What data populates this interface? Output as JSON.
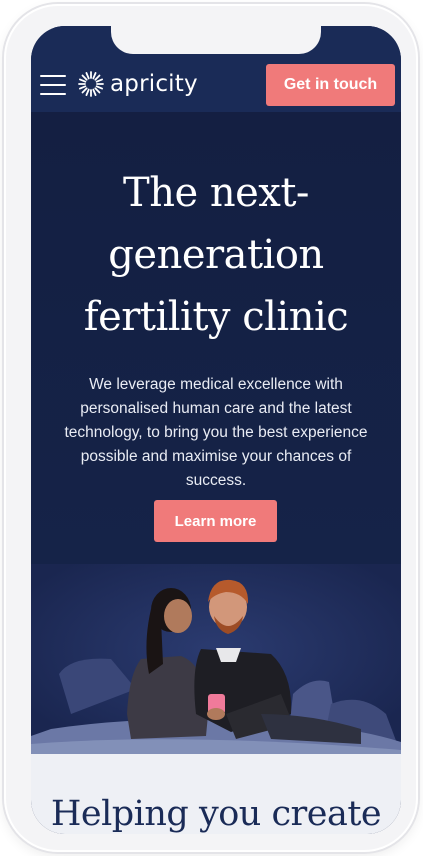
{
  "header": {
    "brand": "apricity",
    "cta_label": "Get in touch"
  },
  "hero": {
    "title_lines": [
      "The next-",
      "generation",
      "fertility clinic"
    ],
    "subtitle_lines": [
      "We leverage medical excellence with",
      "personalised human care and the latest",
      "technology, to bring you the best experience",
      "possible and maximise your chances of success."
    ],
    "button_label": "Learn more"
  },
  "section2": {
    "title": "Helping you create"
  },
  "colors": {
    "navy": "#1a2b57",
    "coral": "#f07a7a",
    "light_bg": "#eef0f5"
  },
  "icons": {
    "menu": "hamburger-menu-icon",
    "logo": "sunburst-logo-icon"
  }
}
